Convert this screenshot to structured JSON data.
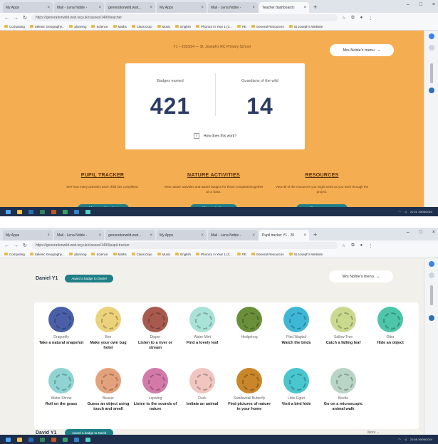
{
  "shot1": {
    "tabs": [
      "My Apps",
      "Mail - Lena Noble -",
      "generationwild.wwt...",
      "My Apps",
      "Mail - Lena Noble -",
      "Teacher dashboard |"
    ],
    "url": "https://generationwild.wwt.org.uk/classes/1490/teacher",
    "bookmarks": [
      "Computing",
      "Selenic Geography...",
      "planning",
      "Science",
      "Maths",
      "Class Dojo",
      "Music",
      "English",
      "Phonics in Year 1 (3...",
      "PE",
      "General Resources",
      "St Joseph's Website"
    ],
    "school_line": "Y1 – 2023/24 — St. Joseph's RC Primary School",
    "menu_label": "Mrs Noble's menu",
    "stats": [
      {
        "label": "Badges earned",
        "value": "421"
      },
      {
        "label": "Guardians of the wild",
        "value": "14"
      }
    ],
    "how_works": "How does this work?",
    "sections": [
      {
        "title": "PUPIL TRACKER",
        "text": "See how many activities each child has completed.",
        "button": "View pupil tracker"
      },
      {
        "title": "NATURE ACTIVITIES",
        "text": "View nature activities and award badges for those completed together as a class.",
        "button": "View activities"
      },
      {
        "title": "RESOURCES",
        "text": "View all of the resources you might need as you work through the project.",
        "button": "View resources"
      }
    ],
    "clock": {
      "time": "21:51",
      "date": "19/06/2024"
    }
  },
  "shot2": {
    "tabs": [
      "My Apps",
      "Mail - Lena Noble -",
      "generationwild.wwt...",
      "My Apps",
      "Mail - Lena Noble -",
      "Pupil tracker Y1 - 20"
    ],
    "url": "https://generationwild.wwt.org.uk/classes/1490/pupil-tracker",
    "bookmarks": [
      "Computing",
      "Selenic Geography...",
      "planning",
      "Science",
      "Maths",
      "Class Dojo",
      "Music",
      "English",
      "Phonics in Year 1 (3...",
      "PE",
      "General Resources",
      "St Joseph's Website"
    ],
    "pupil_name": "Daniel Y1",
    "award_label": "Award a badge to Daniel",
    "menu_label": "Mrs Noble's menu",
    "badges_row1": [
      {
        "name": "Dragonfly",
        "task": "Take a natural snapshot",
        "color": "#4a5fa8"
      },
      {
        "name": "Bee",
        "task": "Make your own bug hotel",
        "color": "#ecd27a"
      },
      {
        "name": "Dipper",
        "task": "Listen to a river or stream",
        "color": "#a85a4e"
      },
      {
        "name": "Water Mint",
        "task": "Find a lovely leaf",
        "color": "#a9e3d8"
      },
      {
        "name": "Hedgehog",
        "task": "",
        "color": "#6a8f3a"
      },
      {
        "name": "Pied Wagtail",
        "task": "Watch the birds",
        "color": "#3eb7d6"
      },
      {
        "name": "Sallow Tree",
        "task": "Catch a falling leaf",
        "color": "#c9d98e"
      },
      {
        "name": "Otter",
        "task": "Hide an object",
        "color": "#4cc5a8"
      }
    ],
    "badges_row2": [
      {
        "name": "Water Shrew",
        "task": "Roll on the grass",
        "color": "#8fd4d3"
      },
      {
        "name": "Beaver",
        "task": "Guess an object using touch and smell",
        "color": "#e4a27c"
      },
      {
        "name": "Lapwing",
        "task": "Listen to the sounds of nature",
        "color": "#d37aa8"
      },
      {
        "name": "Duck",
        "task": "Imitate an animal",
        "color": "#f1c6c0"
      },
      {
        "name": "Swallowtail Butterfly",
        "task": "Find pictures of nature in your home",
        "color": "#c9862a"
      },
      {
        "name": "Little Egret",
        "task": "Visit a bird hide",
        "color": "#49c6ce"
      },
      {
        "name": "Beetle",
        "task": "Go on a microscopic animal walk",
        "color": "#b9d5c6"
      }
    ],
    "next_pupil_name": "David Y1",
    "next_award_label": "Award a badge to David",
    "more_label": "More",
    "clock": {
      "time": "21:58",
      "date": "19/06/2024"
    }
  }
}
